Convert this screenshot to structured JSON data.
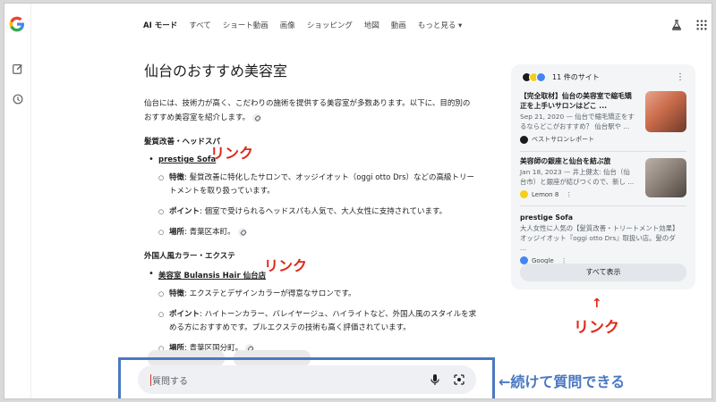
{
  "nav": {
    "tabs": [
      "AI モード",
      "すべて",
      "ショート動画",
      "画像",
      "ショッピング",
      "地図",
      "動画",
      "もっと見る ▾"
    ]
  },
  "article": {
    "title": "仙台のおすすめ美容室",
    "intro": "仙台には、技術力が高く、こだわりの施術を提供する美容室が多数あります。以下に、目的別のおすすめ美容室を紹介します。",
    "sections": [
      {
        "heading": "髪質改善・ヘッドスパ",
        "salon": "prestige Sofa",
        "details": [
          {
            "label": "特徴",
            "text": ": 髪質改善に特化したサロンで、オッジイオット（oggi otto Drs）などの高級トリートメントを取り扱っています。"
          },
          {
            "label": "ポイント",
            "text": ": 個室で受けられるヘッドスパも人気で、大人女性に支持されています。"
          },
          {
            "label": "場所",
            "text": ": 青葉区本町。"
          }
        ]
      },
      {
        "heading": "外国人風カラー・エクステ",
        "salon": "美容室 Bulansis Hair 仙台店",
        "details": [
          {
            "label": "特徴",
            "text": ": エクステとデザインカラーが得意なサロンです。"
          },
          {
            "label": "ポイント",
            "text": ": ハイトーンカラー、バレイヤージュ、ハイライトなど、外国人風のスタイルを求める方におすすめです。プルエクステの技術も高く評価されています。"
          },
          {
            "label": "場所",
            "text": ": 青葉区国分町。"
          }
        ]
      }
    ]
  },
  "annotations": {
    "link1": "リンク",
    "link2": "リンク",
    "panel_link": "リンク",
    "panel_arrow": "↑",
    "continue": "←続けて質問できる"
  },
  "panel": {
    "count": "11 件のサイト",
    "more": "⋮",
    "cards": [
      {
        "title": "【完全取材】仙台の美容室で縮毛矯正を上手いサロンはどこ ...",
        "desc": "Sep 21, 2020 — 仙台で縮毛矯正をするならどこがおすすめ？ 仙台駅や ...",
        "source": "ベストサロンレポート",
        "source_color": "#1a1a1a",
        "img_color": "#c96a4a"
      },
      {
        "title": "美容師の銀座と仙台を結ぶ旅",
        "desc": "Jan 18, 2023 — 井上健太: 仙台（仙台市）と銀座が結びつくので、新し ...",
        "source": "Lemon 8",
        "source_color": "#f4d01c",
        "img_color": "#8a7f76"
      },
      {
        "title": "prestige Sofa",
        "desc": "大人女性に人気の【髪質改善・トリートメント効果】オッジイオット『oggi otto Drs』取扱い店。髪のダ ...",
        "source": "Google",
        "source_color": "#4285f4",
        "img_color": ""
      }
    ],
    "show_all": "すべて表示"
  },
  "search": {
    "placeholder": "質問する"
  },
  "colors": {
    "annotation_red": "#e0271a",
    "annotation_blue": "#4a78c2"
  }
}
